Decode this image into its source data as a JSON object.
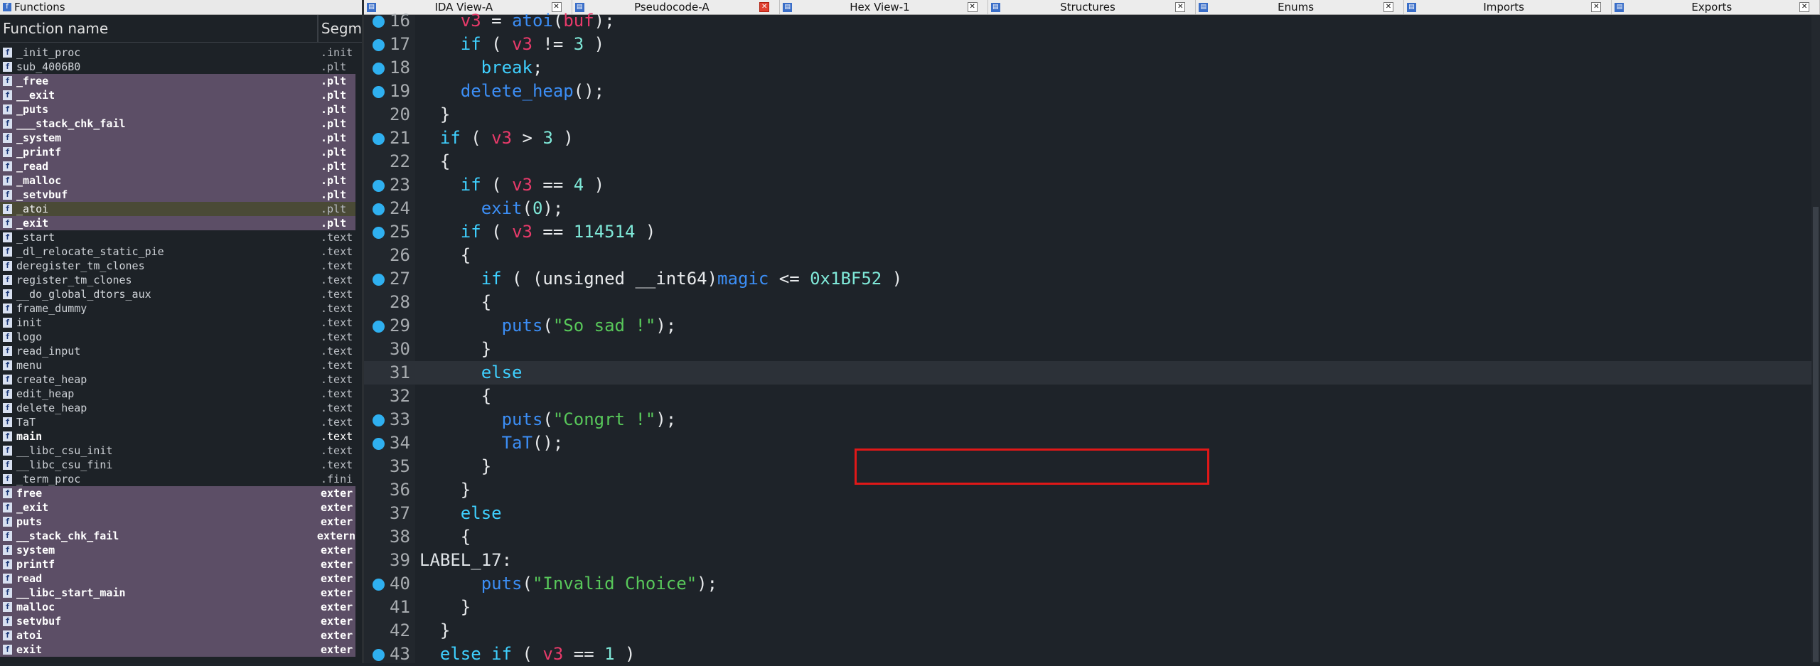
{
  "functions_panel": {
    "title": "Functions",
    "col_name": "Function name",
    "col_segment": "Segm",
    "rows": [
      {
        "name": "_init_proc",
        "segment": ".init",
        "style": ""
      },
      {
        "name": "sub_4006B0",
        "segment": ".plt",
        "style": ""
      },
      {
        "name": "_free",
        "segment": ".plt",
        "style": "hl"
      },
      {
        "name": "__exit",
        "segment": ".plt",
        "style": "hl"
      },
      {
        "name": "_puts",
        "segment": ".plt",
        "style": "hl"
      },
      {
        "name": "___stack_chk_fail",
        "segment": ".plt",
        "style": "hl"
      },
      {
        "name": "_system",
        "segment": ".plt",
        "style": "hl"
      },
      {
        "name": "_printf",
        "segment": ".plt",
        "style": "hl"
      },
      {
        "name": "_read",
        "segment": ".plt",
        "style": "hl"
      },
      {
        "name": "_malloc",
        "segment": ".plt",
        "style": "hl"
      },
      {
        "name": "_setvbuf",
        "segment": ".plt",
        "style": "hl"
      },
      {
        "name": "_atoi",
        "segment": ".plt",
        "style": "sel"
      },
      {
        "name": "_exit",
        "segment": ".plt",
        "style": "hl"
      },
      {
        "name": "_start",
        "segment": ".text",
        "style": ""
      },
      {
        "name": "_dl_relocate_static_pie",
        "segment": ".text",
        "style": ""
      },
      {
        "name": "deregister_tm_clones",
        "segment": ".text",
        "style": ""
      },
      {
        "name": "register_tm_clones",
        "segment": ".text",
        "style": ""
      },
      {
        "name": "__do_global_dtors_aux",
        "segment": ".text",
        "style": ""
      },
      {
        "name": "frame_dummy",
        "segment": ".text",
        "style": ""
      },
      {
        "name": "init",
        "segment": ".text",
        "style": ""
      },
      {
        "name": "logo",
        "segment": ".text",
        "style": ""
      },
      {
        "name": "read_input",
        "segment": ".text",
        "style": ""
      },
      {
        "name": "menu",
        "segment": ".text",
        "style": ""
      },
      {
        "name": "create_heap",
        "segment": ".text",
        "style": ""
      },
      {
        "name": "edit_heap",
        "segment": ".text",
        "style": ""
      },
      {
        "name": "delete_heap",
        "segment": ".text",
        "style": ""
      },
      {
        "name": "TaT",
        "segment": ".text",
        "style": ""
      },
      {
        "name": "main",
        "segment": ".text",
        "style": "extern"
      },
      {
        "name": "__libc_csu_init",
        "segment": ".text",
        "style": ""
      },
      {
        "name": "__libc_csu_fini",
        "segment": ".text",
        "style": ""
      },
      {
        "name": "_term_proc",
        "segment": ".fini",
        "style": ""
      },
      {
        "name": "free",
        "segment": "exter",
        "style": "hl"
      },
      {
        "name": "_exit",
        "segment": "exter",
        "style": "hl"
      },
      {
        "name": "puts",
        "segment": "exter",
        "style": "hl"
      },
      {
        "name": "__stack_chk_fail",
        "segment": "extern",
        "style": "hl"
      },
      {
        "name": "system",
        "segment": "exter",
        "style": "hl"
      },
      {
        "name": "printf",
        "segment": "exter",
        "style": "hl"
      },
      {
        "name": "read",
        "segment": "exter",
        "style": "hl"
      },
      {
        "name": "__libc_start_main",
        "segment": "exter",
        "style": "hl"
      },
      {
        "name": "malloc",
        "segment": "exter",
        "style": "hl"
      },
      {
        "name": "setvbuf",
        "segment": "exter",
        "style": "hl"
      },
      {
        "name": "atoi",
        "segment": "exter",
        "style": "hl"
      },
      {
        "name": "exit",
        "segment": "exter",
        "style": "hl"
      }
    ]
  },
  "tabs": [
    {
      "label": "IDA View-A",
      "active": false
    },
    {
      "label": "Pseudocode-A",
      "active": true
    },
    {
      "label": "Hex View-1",
      "active": false
    },
    {
      "label": "Structures",
      "active": false
    },
    {
      "label": "Enums",
      "active": false
    },
    {
      "label": "Imports",
      "active": false
    },
    {
      "label": "Exports",
      "active": false
    }
  ],
  "code_lines": [
    {
      "num": "16",
      "bp": true,
      "cur": false,
      "parts": [
        [
          "",
          "    "
        ],
        [
          "var",
          "v3"
        ],
        [
          "",
          " = "
        ],
        [
          "fnc",
          "atoi"
        ],
        [
          "",
          "("
        ],
        [
          "var",
          "buf"
        ],
        [
          "",
          ");"
        ]
      ]
    },
    {
      "num": "17",
      "bp": true,
      "cur": false,
      "parts": [
        [
          "",
          "    "
        ],
        [
          "kw",
          "if"
        ],
        [
          "",
          " ( "
        ],
        [
          "var",
          "v3"
        ],
        [
          "",
          " != "
        ],
        [
          "numl",
          "3"
        ],
        [
          "",
          " )"
        ]
      ]
    },
    {
      "num": "18",
      "bp": true,
      "cur": false,
      "parts": [
        [
          "",
          "      "
        ],
        [
          "kw",
          "break"
        ],
        [
          "",
          ";"
        ]
      ]
    },
    {
      "num": "19",
      "bp": true,
      "cur": false,
      "parts": [
        [
          "",
          "    "
        ],
        [
          "fnc",
          "delete_heap"
        ],
        [
          "",
          "();"
        ]
      ]
    },
    {
      "num": "20",
      "bp": false,
      "cur": false,
      "parts": [
        [
          "",
          "  }"
        ]
      ]
    },
    {
      "num": "21",
      "bp": true,
      "cur": false,
      "parts": [
        [
          "",
          "  "
        ],
        [
          "kw",
          "if"
        ],
        [
          "",
          " ( "
        ],
        [
          "var",
          "v3"
        ],
        [
          "",
          " > "
        ],
        [
          "numl",
          "3"
        ],
        [
          "",
          " )"
        ]
      ]
    },
    {
      "num": "22",
      "bp": false,
      "cur": false,
      "parts": [
        [
          "",
          "  {"
        ]
      ]
    },
    {
      "num": "23",
      "bp": true,
      "cur": false,
      "parts": [
        [
          "",
          "    "
        ],
        [
          "kw",
          "if"
        ],
        [
          "",
          " ( "
        ],
        [
          "var",
          "v3"
        ],
        [
          "",
          " == "
        ],
        [
          "numl",
          "4"
        ],
        [
          "",
          " )"
        ]
      ]
    },
    {
      "num": "24",
      "bp": true,
      "cur": false,
      "parts": [
        [
          "",
          "      "
        ],
        [
          "fnc",
          "exit"
        ],
        [
          "",
          "("
        ],
        [
          "numl",
          "0"
        ],
        [
          "",
          ");"
        ]
      ]
    },
    {
      "num": "25",
      "bp": true,
      "cur": false,
      "parts": [
        [
          "",
          "    "
        ],
        [
          "kw",
          "if"
        ],
        [
          "",
          " ( "
        ],
        [
          "var",
          "v3"
        ],
        [
          "",
          " == "
        ],
        [
          "numl",
          "114514"
        ],
        [
          "",
          " )"
        ]
      ]
    },
    {
      "num": "26",
      "bp": false,
      "cur": false,
      "parts": [
        [
          "",
          "    {"
        ]
      ]
    },
    {
      "num": "27",
      "bp": true,
      "cur": false,
      "parts": [
        [
          "",
          "      "
        ],
        [
          "kw",
          "if"
        ],
        [
          "",
          " ( (unsigned __int64)"
        ],
        [
          "fnc",
          "magic"
        ],
        [
          "",
          " <= "
        ],
        [
          "numl",
          "0x1BF52"
        ],
        [
          "",
          " )"
        ]
      ]
    },
    {
      "num": "28",
      "bp": false,
      "cur": false,
      "parts": [
        [
          "",
          "      {"
        ]
      ]
    },
    {
      "num": "29",
      "bp": true,
      "cur": false,
      "parts": [
        [
          "",
          "        "
        ],
        [
          "fnc",
          "puts"
        ],
        [
          "",
          "("
        ],
        [
          "str",
          "\"So sad !\""
        ],
        [
          "",
          ");"
        ]
      ]
    },
    {
      "num": "30",
      "bp": false,
      "cur": false,
      "parts": [
        [
          "",
          "      }"
        ]
      ]
    },
    {
      "num": "31",
      "bp": false,
      "cur": true,
      "parts": [
        [
          "",
          "      "
        ],
        [
          "kw",
          "else"
        ]
      ]
    },
    {
      "num": "32",
      "bp": false,
      "cur": false,
      "parts": [
        [
          "",
          "      {"
        ]
      ]
    },
    {
      "num": "33",
      "bp": true,
      "cur": false,
      "parts": [
        [
          "",
          "        "
        ],
        [
          "fnc",
          "puts"
        ],
        [
          "",
          "("
        ],
        [
          "str",
          "\"Congrt !\""
        ],
        [
          "",
          ");"
        ]
      ]
    },
    {
      "num": "34",
      "bp": true,
      "cur": false,
      "parts": [
        [
          "",
          "        "
        ],
        [
          "fnc",
          "TaT"
        ],
        [
          "",
          "();"
        ]
      ]
    },
    {
      "num": "35",
      "bp": false,
      "cur": false,
      "parts": [
        [
          "",
          "      }"
        ]
      ]
    },
    {
      "num": "36",
      "bp": false,
      "cur": false,
      "parts": [
        [
          "",
          "    }"
        ]
      ]
    },
    {
      "num": "37",
      "bp": false,
      "cur": false,
      "parts": [
        [
          "",
          "    "
        ],
        [
          "kw",
          "else"
        ]
      ]
    },
    {
      "num": "38",
      "bp": false,
      "cur": false,
      "parts": [
        [
          "",
          "    {"
        ]
      ]
    },
    {
      "num": "39",
      "bp": false,
      "cur": false,
      "parts": [
        [
          "lbl",
          "LABEL_17"
        ],
        [
          "",
          ":"
        ]
      ],
      "label": true
    },
    {
      "num": "40",
      "bp": true,
      "cur": false,
      "parts": [
        [
          "",
          "      "
        ],
        [
          "fnc",
          "puts"
        ],
        [
          "",
          "("
        ],
        [
          "str",
          "\"Invalid Choice\""
        ],
        [
          "",
          ");"
        ]
      ]
    },
    {
      "num": "41",
      "bp": false,
      "cur": false,
      "parts": [
        [
          "",
          "    }"
        ]
      ]
    },
    {
      "num": "42",
      "bp": false,
      "cur": false,
      "parts": [
        [
          "",
          "  }"
        ]
      ]
    },
    {
      "num": "43",
      "bp": true,
      "cur": false,
      "parts": [
        [
          "",
          "  "
        ],
        [
          "kw",
          "else if"
        ],
        [
          "",
          " ( "
        ],
        [
          "var",
          "v3"
        ],
        [
          "",
          " == "
        ],
        [
          "numl",
          "1"
        ],
        [
          "",
          " )"
        ]
      ]
    }
  ]
}
